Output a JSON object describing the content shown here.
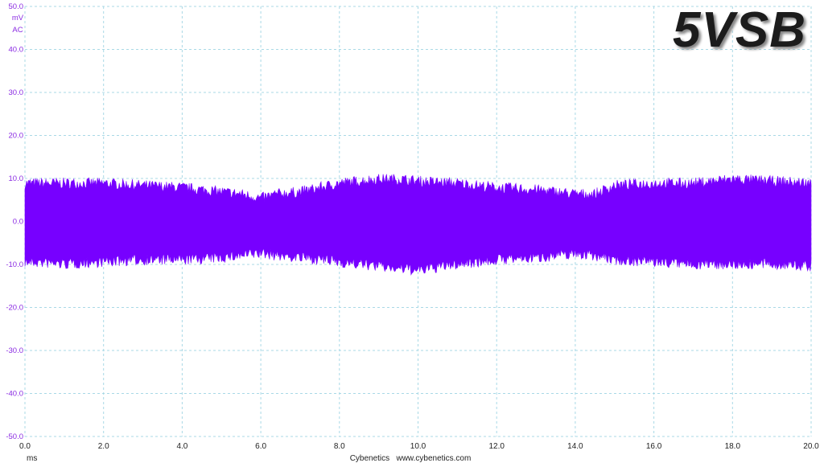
{
  "badge_text": "5VSB",
  "unit_label": "mV",
  "mode_label": "AC",
  "footer": {
    "x_unit": "ms",
    "credit": "Cybenetics   www.cybenetics.com"
  },
  "colors": {
    "signal": "#7700ff",
    "grid": "#a9d9e6",
    "y_axis_text": "#8a2be2"
  },
  "chart_data": {
    "type": "area",
    "title": "5VSB",
    "xlabel": "ms",
    "ylabel": "mV AC",
    "xlim": [
      0.0,
      20.0
    ],
    "ylim": [
      -50.0,
      50.0
    ],
    "x_ticks": [
      "0.0",
      "2.0",
      "4.0",
      "6.0",
      "8.0",
      "10.0",
      "12.0",
      "14.0",
      "16.0",
      "18.0",
      "20.0"
    ],
    "y_ticks": [
      "50.0",
      "40.0",
      "30.0",
      "20.0",
      "10.0",
      "0.0",
      "-10.0",
      "-20.0",
      "-30.0",
      "-40.0",
      "-50.0"
    ],
    "grid": true,
    "series": [
      {
        "name": "",
        "x": [
          0.0,
          1.0,
          2.0,
          3.0,
          4.0,
          5.0,
          5.5,
          6.0,
          6.4,
          7.0,
          8.0,
          9.0,
          9.5,
          10.0,
          11.0,
          12.0,
          13.0,
          13.5,
          14.0,
          14.5,
          15.0,
          16.0,
          17.0,
          18.0,
          19.0,
          20.0
        ],
        "upper": [
          9.0,
          9.0,
          9.0,
          8.5,
          8.0,
          7.0,
          6.5,
          5.5,
          6.5,
          7.0,
          9.0,
          10.0,
          10.0,
          9.5,
          9.0,
          8.0,
          7.5,
          7.0,
          6.5,
          6.5,
          8.5,
          9.0,
          9.0,
          10.0,
          9.5,
          9.0
        ],
        "lower": [
          -9.5,
          -10.0,
          -9.5,
          -9.0,
          -9.0,
          -8.5,
          -8.0,
          -7.5,
          -8.0,
          -8.5,
          -9.5,
          -10.5,
          -11.0,
          -11.5,
          -10.0,
          -9.0,
          -8.5,
          -8.0,
          -7.5,
          -8.0,
          -9.0,
          -9.5,
          -10.0,
          -10.0,
          -10.0,
          -10.5
        ],
        "max_peak": 11.0,
        "min_peak": -13.0
      }
    ]
  }
}
